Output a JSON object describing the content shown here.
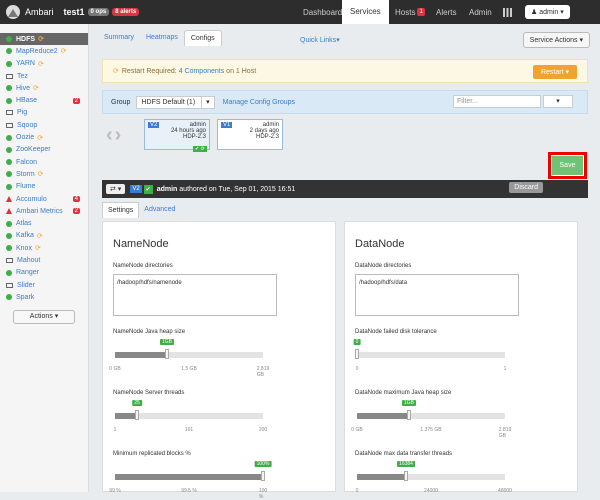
{
  "topbar": {
    "brand": "Ambari",
    "cluster": "test1",
    "ops_badge": "0 ops",
    "alerts_badge": "8 alerts",
    "nav": [
      "Dashboard",
      "Services",
      "Hosts",
      "Alerts",
      "Admin"
    ],
    "hosts_count": "1",
    "user": "admin"
  },
  "sidebar": {
    "items": [
      {
        "label": "HDFS",
        "status": "ok",
        "restart": true
      },
      {
        "label": "MapReduce2",
        "status": "ok",
        "restart": true
      },
      {
        "label": "YARN",
        "status": "ok",
        "restart": true
      },
      {
        "label": "Tez",
        "status": "client",
        "restart": false
      },
      {
        "label": "Hive",
        "status": "ok",
        "restart": true
      },
      {
        "label": "HBase",
        "status": "ok",
        "restart": false,
        "count": "2"
      },
      {
        "label": "Pig",
        "status": "client",
        "restart": false
      },
      {
        "label": "Sqoop",
        "status": "client",
        "restart": false
      },
      {
        "label": "Oozie",
        "status": "ok",
        "restart": true
      },
      {
        "label": "ZooKeeper",
        "status": "ok",
        "restart": false
      },
      {
        "label": "Falcon",
        "status": "ok",
        "restart": false
      },
      {
        "label": "Storm",
        "status": "ok",
        "restart": true
      },
      {
        "label": "Flume",
        "status": "ok",
        "restart": false
      },
      {
        "label": "Accumulo",
        "status": "warn",
        "restart": false,
        "count": "4"
      },
      {
        "label": "Ambari Metrics",
        "status": "warn",
        "restart": false,
        "count": "2"
      },
      {
        "label": "Atlas",
        "status": "ok",
        "restart": false
      },
      {
        "label": "Kafka",
        "status": "ok",
        "restart": true
      },
      {
        "label": "Knox",
        "status": "ok",
        "restart": true
      },
      {
        "label": "Mahout",
        "status": "client",
        "restart": false
      },
      {
        "label": "Ranger",
        "status": "ok",
        "restart": false
      },
      {
        "label": "Slider",
        "status": "client",
        "restart": false
      },
      {
        "label": "Spark",
        "status": "ok",
        "restart": false
      }
    ],
    "actions_label": "Actions"
  },
  "tabs": [
    "Summary",
    "Heatmaps",
    "Configs"
  ],
  "quick_links": "Quick Links",
  "service_actions": "Service Actions",
  "restart_bar": {
    "prefix": "Restart Required:",
    "link": "4 Components",
    "suffix": "on 1 Host",
    "button": "Restart"
  },
  "group_bar": {
    "label": "Group",
    "selected": "HDFS Default (1)",
    "manage": "Manage Config Groups",
    "filter_placeholder": "Filter..."
  },
  "versions": [
    {
      "tag": "V2",
      "user": "admin",
      "time": "24 hours ago",
      "stack": "HDP-2.3"
    },
    {
      "tag": "V1",
      "user": "admin",
      "time": "2 days ago",
      "stack": "HDP-2.3"
    }
  ],
  "authorbar": {
    "version": "V2",
    "user": "admin",
    "text": "authored on Tue, Sep 01, 2015 16:51",
    "discard": "Discard",
    "save": "Save"
  },
  "subtabs": [
    "Settings",
    "Advanced"
  ],
  "namenode": {
    "title": "NameNode",
    "dirs_label": "NameNode directories",
    "dirs_value": "/hadoop/hdfs/namenode",
    "heap_label": "NameNode Java heap size",
    "heap_value": "1GB",
    "heap_fraction": 0.35,
    "heap_ticks": [
      "0 GB",
      "1.5 GB",
      "2.819 GB"
    ],
    "threads_label": "NameNode Server threads",
    "threads_value": "25",
    "threads_fraction": 0.15,
    "threads_ticks": [
      "1",
      "101",
      "200"
    ],
    "repl_label": "Minimum replicated blocks %",
    "repl_value": "100%",
    "repl_fraction": 1.0,
    "repl_ticks": [
      "99 %",
      "99.5 %",
      "100 %"
    ]
  },
  "datanode": {
    "title": "DataNode",
    "dirs_label": "DataNode directories",
    "dirs_value": "/hadoop/hdfs/data",
    "fail_label": "DataNode failed disk tolerance",
    "fail_value": "0",
    "fail_fraction": 0.0,
    "fail_ticks": [
      "0",
      "1"
    ],
    "heap_label": "DataNode maximum Java heap size",
    "heap_value": "1GB",
    "heap_fraction": 0.35,
    "heap_ticks": [
      "0 GB",
      "1.375 GB",
      "2.819 GB"
    ],
    "xfer_label": "DataNode max data transfer threads",
    "xfer_value": "16384",
    "xfer_fraction": 0.33,
    "xfer_ticks": [
      "0",
      "24000",
      "48000"
    ]
  }
}
